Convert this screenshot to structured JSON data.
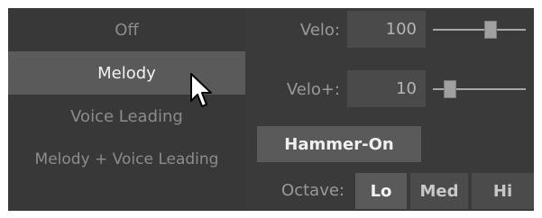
{
  "mode_list": {
    "items": [
      {
        "label": "Off"
      },
      {
        "label": "Melody"
      },
      {
        "label": "Voice Leading"
      },
      {
        "label": "Melody + Voice Leading"
      }
    ],
    "selected": "Melody"
  },
  "velo": {
    "label": "Velo:",
    "value": "100",
    "slider_level": 0.64
  },
  "velo_plus": {
    "label": "Velo+:",
    "value": "10",
    "slider_level": 0.14
  },
  "hammer_on": {
    "label": "Hammer-On"
  },
  "octave": {
    "label": "Octave:",
    "options": [
      {
        "label": "Lo"
      },
      {
        "label": "Med"
      },
      {
        "label": "Hi"
      }
    ],
    "selected": "Lo"
  },
  "icons": {
    "cursor": "mouse-pointer-icon"
  },
  "colors": {
    "panel_bg": "#3a3a3a",
    "selected_bg": "#5a5a5a",
    "value_box_bg": "#4a4a4a",
    "label_text": "#9a9a9a",
    "selected_text": "#f2f2f2"
  }
}
